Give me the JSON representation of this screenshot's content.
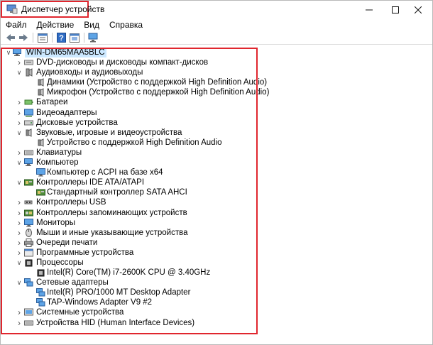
{
  "window": {
    "title": "Диспетчер устройств"
  },
  "menu": {
    "items": [
      "Файл",
      "Действие",
      "Вид",
      "Справка"
    ]
  },
  "toolbar": {
    "buttons": [
      "back-arrow-icon",
      "forward-arrow-icon",
      "properties-icon",
      "help-icon",
      "update-driver-icon",
      "monitor-scan-icon"
    ]
  },
  "tree": {
    "root": "WIN-DM65MAA5BLC",
    "items": [
      {
        "label": "DVD-дисководы и дисководы компакт-дисков",
        "icon": "dvd-drive-icon",
        "level": 1,
        "state": "collapsed"
      },
      {
        "label": "Аудиовходы и аудиовыходы",
        "icon": "audio-io-icon",
        "level": 1,
        "state": "expanded"
      },
      {
        "label": "Динамики (Устройство с поддержкой High Definition Audio)",
        "icon": "speaker-icon",
        "level": 2,
        "state": "leaf"
      },
      {
        "label": "Микрофон (Устройство с поддержкой High Definition Audio)",
        "icon": "microphone-icon",
        "level": 2,
        "state": "leaf"
      },
      {
        "label": "Батареи",
        "icon": "battery-icon",
        "level": 1,
        "state": "collapsed"
      },
      {
        "label": "Видеоадаптеры",
        "icon": "display-adapter-icon",
        "level": 1,
        "state": "collapsed"
      },
      {
        "label": "Дисковые устройства",
        "icon": "disk-drive-icon",
        "level": 1,
        "state": "collapsed"
      },
      {
        "label": "Звуковые, игровые и видеоустройства",
        "icon": "sound-device-icon",
        "level": 1,
        "state": "expanded"
      },
      {
        "label": "Устройство с поддержкой High Definition Audio",
        "icon": "speaker-icon",
        "level": 2,
        "state": "leaf"
      },
      {
        "label": "Клавиатуры",
        "icon": "keyboard-icon",
        "level": 1,
        "state": "collapsed"
      },
      {
        "label": "Компьютер",
        "icon": "computer-icon",
        "level": 1,
        "state": "expanded"
      },
      {
        "label": "Компьютер с ACPI на базе x64",
        "icon": "monitor-icon",
        "level": 2,
        "state": "leaf"
      },
      {
        "label": "Контроллеры IDE ATA/ATAPI",
        "icon": "ide-controller-icon",
        "level": 1,
        "state": "expanded"
      },
      {
        "label": "Стандартный контроллер SATA AHCI",
        "icon": "ide-controller-icon",
        "level": 2,
        "state": "leaf"
      },
      {
        "label": "Контроллеры USB",
        "icon": "usb-icon",
        "level": 1,
        "state": "collapsed"
      },
      {
        "label": "Контроллеры запоминающих устройств",
        "icon": "storage-controller-icon",
        "level": 1,
        "state": "collapsed"
      },
      {
        "label": "Мониторы",
        "icon": "monitor-icon",
        "level": 1,
        "state": "collapsed"
      },
      {
        "label": "Мыши и иные указывающие устройства",
        "icon": "mouse-icon",
        "level": 1,
        "state": "collapsed"
      },
      {
        "label": "Очереди печати",
        "icon": "printer-icon",
        "level": 1,
        "state": "collapsed"
      },
      {
        "label": "Программные устройства",
        "icon": "software-device-icon",
        "level": 1,
        "state": "collapsed"
      },
      {
        "label": "Процессоры",
        "icon": "processor-icon",
        "level": 1,
        "state": "expanded"
      },
      {
        "label": "Intel(R) Core(TM) i7-2600K CPU @ 3.40GHz",
        "icon": "processor-icon",
        "level": 2,
        "state": "leaf"
      },
      {
        "label": "Сетевые адаптеры",
        "icon": "network-adapter-icon",
        "level": 1,
        "state": "expanded"
      },
      {
        "label": "Intel(R) PRO/1000 MT Desktop Adapter",
        "icon": "network-adapter-icon",
        "level": 2,
        "state": "leaf"
      },
      {
        "label": "TAP-Windows Adapter V9 #2",
        "icon": "network-adapter-icon",
        "level": 2,
        "state": "leaf"
      },
      {
        "label": "Системные устройства",
        "icon": "system-device-icon",
        "level": 1,
        "state": "collapsed"
      },
      {
        "label": "Устройства HID (Human Interface Devices)",
        "icon": "hid-device-icon",
        "level": 1,
        "state": "collapsed"
      }
    ]
  },
  "colors": {
    "highlight": "#e0262e",
    "selection": "#cce8ff"
  }
}
